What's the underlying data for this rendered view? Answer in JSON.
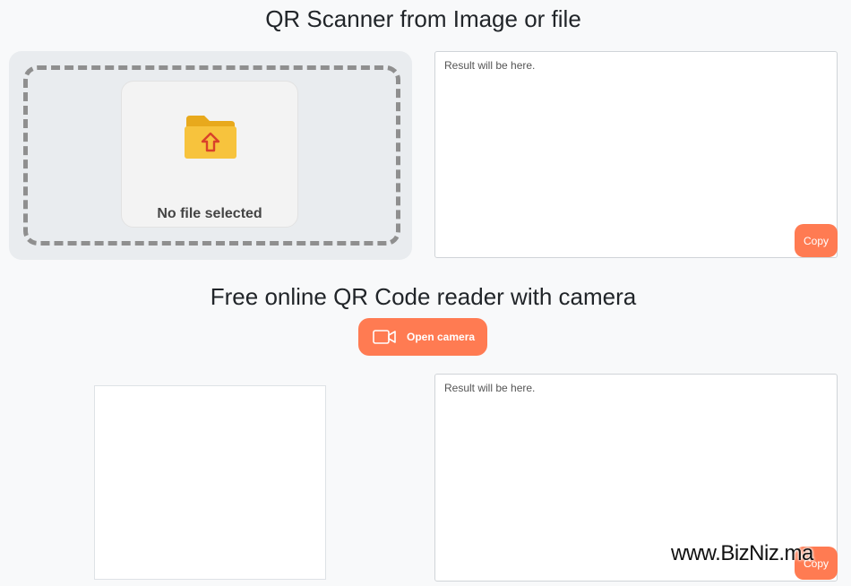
{
  "scanner": {
    "title": "QR Scanner from Image or file",
    "file_status": "No file selected",
    "result_placeholder": "Result will be here.",
    "copy_label": "Copy"
  },
  "camera": {
    "title": "Free online QR Code reader with camera",
    "open_label": "Open camera",
    "result_placeholder": "Result will be here.",
    "copy_label": "Copy"
  },
  "watermark": "www.BizNiz.ma",
  "colors": {
    "accent": "#ff7b52",
    "folder": "#f7c33d",
    "folder_arrow": "#d9412a"
  },
  "icons": [
    "folder-upload-icon",
    "video-camera-icon"
  ]
}
